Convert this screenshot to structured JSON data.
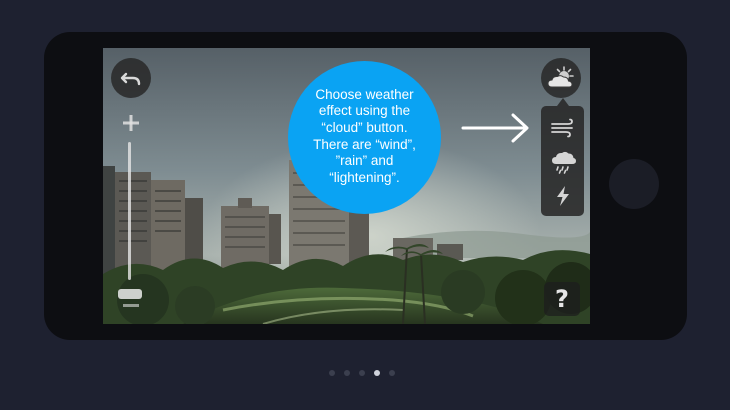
{
  "tutorial": {
    "callout_text": "Choose weather effect using the “cloud” button. There are “wind”, ”rain” and “lightening”."
  },
  "toolbar": {
    "help_label": "?"
  },
  "icons": {
    "undo": "undo-arrow",
    "zoom_in": "plus",
    "zoom_out": "minus",
    "weather": "sun-behind-cloud",
    "wind": "wind-lines",
    "rain": "rain-cloud",
    "lightning": "lightning-bolt",
    "help": "question-mark",
    "pointer": "arrow-right"
  },
  "weather_effects": [
    "wind",
    "rain",
    "lightening"
  ],
  "pagination": {
    "total": 5,
    "current": 4
  },
  "colors": {
    "callout_bg": "#0aa3f3",
    "page_bg": "#1e2130",
    "phone_body": "#0d0e12",
    "control_bg": "#282828",
    "dot_active": "#cfd2db",
    "dot_inactive": "#3b3f4e"
  }
}
